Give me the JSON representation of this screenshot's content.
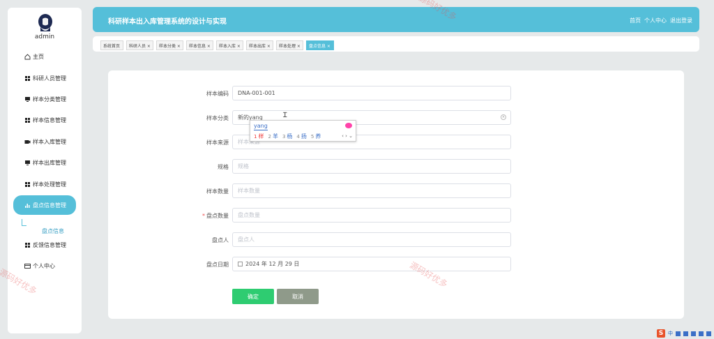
{
  "sidebar": {
    "username": "admin",
    "menu": [
      {
        "label": "主页",
        "icon": "home-icon"
      },
      {
        "label": "科研人员管理",
        "icon": "grid-icon"
      },
      {
        "label": "样本分类管理",
        "icon": "monitor-icon"
      },
      {
        "label": "样本信息管理",
        "icon": "grid-icon"
      },
      {
        "label": "样本入库管理",
        "icon": "camera-icon"
      },
      {
        "label": "样本出库管理",
        "icon": "monitor-icon"
      },
      {
        "label": "样本处理管理",
        "icon": "grid-icon"
      },
      {
        "label": "盘点信息管理",
        "icon": "bar-chart-icon"
      },
      {
        "label": "反馈信息管理",
        "icon": "grid-icon"
      },
      {
        "label": "个人中心",
        "icon": "card-icon"
      }
    ],
    "submenu_label": "盘点信息"
  },
  "header": {
    "title": "科研样本出入库管理系统的设计与实现",
    "links": [
      "首页",
      "个人中心",
      "退出登录"
    ]
  },
  "tabs": [
    {
      "label": "系统首页"
    },
    {
      "label": "科研人员 ×"
    },
    {
      "label": "样本分类 ×"
    },
    {
      "label": "样本信息 ×"
    },
    {
      "label": "样本入库 ×"
    },
    {
      "label": "样本出库 ×"
    },
    {
      "label": "样本处理 ×"
    },
    {
      "label": "盘点信息 ×"
    }
  ],
  "form": {
    "fields": [
      {
        "label": "样本编码",
        "value": "DNA-001-001",
        "placeholder": ""
      },
      {
        "label": "样本分类",
        "value": "新的yang",
        "placeholder": ""
      },
      {
        "label": "样本来源",
        "value": "",
        "placeholder": "样本来源"
      },
      {
        "label": "规格",
        "value": "",
        "placeholder": "规格"
      },
      {
        "label": "样本数量",
        "value": "",
        "placeholder": "样本数量"
      },
      {
        "label": "盘点数量",
        "value": "",
        "placeholder": "盘点数量",
        "required": true
      },
      {
        "label": "盘点人",
        "value": "",
        "placeholder": "盘点人"
      },
      {
        "label": "盘点日期",
        "value": "2024 年 12 月 29 日",
        "placeholder": ""
      }
    ],
    "confirm_label": "确定",
    "cancel_label": "取消"
  },
  "ime": {
    "composition": "yang",
    "candidates": [
      {
        "n": "1",
        "c": "样"
      },
      {
        "n": "2",
        "c": "羊"
      },
      {
        "n": "3",
        "c": "杨"
      },
      {
        "n": "4",
        "c": "扬"
      },
      {
        "n": "5",
        "c": "养"
      }
    ],
    "nav": "‹ › ⌄"
  },
  "watermark": "源码好优多",
  "tray": {
    "logo": "S",
    "lang": "中"
  },
  "colors": {
    "accent": "#55bfd9",
    "confirm": "#2ecc71",
    "cancel": "#8f9a8a"
  }
}
